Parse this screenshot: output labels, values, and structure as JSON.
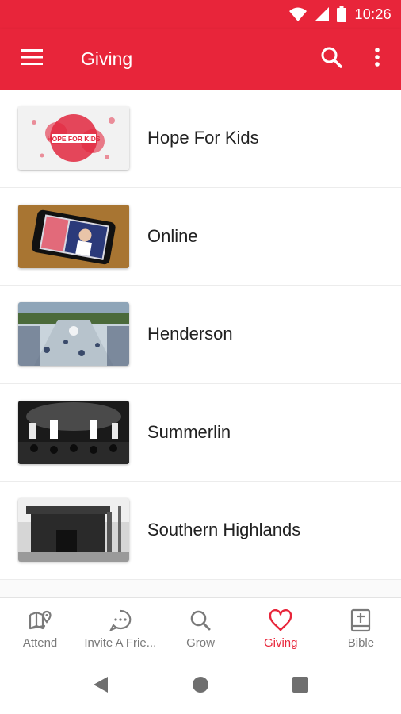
{
  "status_bar": {
    "time": "10:26"
  },
  "app_bar": {
    "title": "Giving"
  },
  "list": {
    "items": [
      {
        "label": "Hope For Kids",
        "thumb_text": "HOPE FOR KIDS"
      },
      {
        "label": "Online"
      },
      {
        "label": "Henderson"
      },
      {
        "label": "Summerlin"
      },
      {
        "label": "Southern Highlands"
      }
    ]
  },
  "bottom_nav": {
    "items": [
      {
        "label": "Attend",
        "icon": "map-pin-icon"
      },
      {
        "label": "Invite A Frie...",
        "icon": "chat-bubble-icon"
      },
      {
        "label": "Grow",
        "icon": "search-icon"
      },
      {
        "label": "Giving",
        "icon": "heart-icon",
        "active": true
      },
      {
        "label": "Bible",
        "icon": "bible-icon"
      }
    ]
  },
  "colors": {
    "brand": "#e8253a",
    "text": "#212121",
    "inactive": "#7a7a7a"
  }
}
